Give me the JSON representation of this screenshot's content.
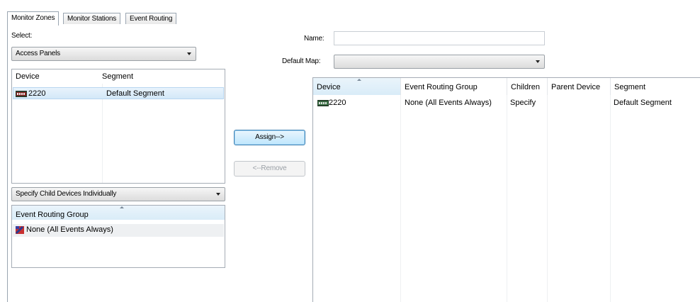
{
  "tabs": [
    {
      "label": "Monitor Zones",
      "active": true
    },
    {
      "label": "Monitor Stations",
      "active": false
    },
    {
      "label": "Event Routing",
      "active": false
    }
  ],
  "left": {
    "select_label": "Select:",
    "select_value": "Access Panels",
    "device_list": {
      "columns": [
        "Device",
        "Segment"
      ],
      "rows": [
        {
          "device": "2220",
          "segment": "Default Segment",
          "icon": "panel-icon",
          "selected": true
        }
      ]
    },
    "child_mode_value": "Specify Child Devices Individually",
    "routing_list": {
      "columns": [
        "Event Routing Group"
      ],
      "rows": [
        {
          "name": "None (All Events Always)",
          "icon": "event-group-icon"
        }
      ]
    }
  },
  "middle": {
    "assign_label": "Assign-->",
    "remove_label": "<--Remove"
  },
  "right": {
    "name_label": "Name:",
    "name_value": "",
    "default_map_label": "Default Map:",
    "default_map_value": "",
    "assigned_list": {
      "columns": [
        "Device",
        "Event Routing Group",
        "Children",
        "Parent Device",
        "Segment"
      ],
      "rows": [
        {
          "device": "2220",
          "event_routing_group": "None (All Events Always)",
          "children": "Specify",
          "parent_device": "",
          "segment": "Default Segment",
          "icon": "panel-icon"
        }
      ]
    }
  },
  "colors": {
    "selection": "#d3e8f8",
    "border": "#a5acb5",
    "default_button": "#bee6fd"
  }
}
